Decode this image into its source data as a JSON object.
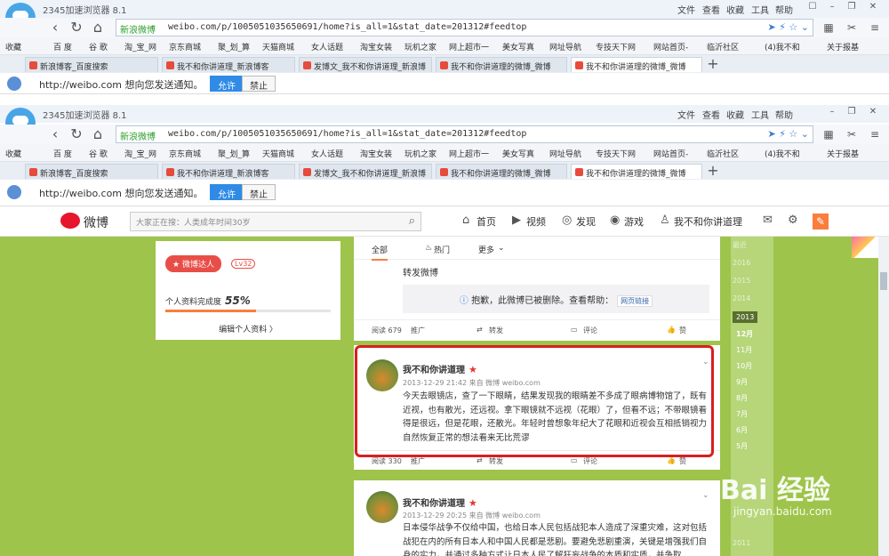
{
  "browser": {
    "app_title": "2345加速浏览器 8.1",
    "menus": [
      "文件",
      "查看",
      "收藏",
      "工具",
      "帮助"
    ],
    "site_label": "新浪微博",
    "url": "weibo.com/p/1005051035650691/home?is_all=1&stat_date=201312#feedtop",
    "bookmarks": [
      "收藏",
      "百 度",
      "谷 歌",
      "淘_宝_网",
      "京东商城",
      "聚_划_算",
      "天猫商城",
      "女人话题",
      "淘宝女装",
      "玩机之家",
      "网上超市一",
      "美女写真",
      "网址导航",
      "专技天下网",
      "网站首页-",
      "临沂社区",
      "(4)我不和",
      "关于报基"
    ],
    "tabs": [
      "新浪博客_百度搜索",
      "我不和你讲道理_新浪博客",
      "发博文_我不和你讲道理_新浪博",
      "我不和你讲道理的微博_微博",
      "我不和你讲道理的微博_微博"
    ],
    "notification": {
      "text": "http://weibo.com 想向您发送通知。",
      "allow": "允许",
      "deny": "禁止"
    }
  },
  "weibo": {
    "logo_text": "微博",
    "search_placeholder": "大家正在搜：人类成年时间30岁",
    "nav": [
      "首页",
      "视频",
      "发现",
      "游戏",
      "我不和你讲道理"
    ]
  },
  "profile": {
    "badge": "微博达人",
    "level": "Lv32",
    "completeness_label": "个人资料完成度",
    "completeness": "55%",
    "completeness_fraction": 0.55,
    "edit_link": "编辑个人资料 〉"
  },
  "feed": {
    "tabs": [
      "全部",
      "热门",
      "更多"
    ],
    "card1": {
      "repost_label": "转发微博",
      "deleted_text": "抱歉，此微博已被删除。查看帮助：",
      "web_link": "网页链接",
      "actions": [
        "阅读 679",
        "推广",
        "转发",
        "评论",
        "赞"
      ]
    },
    "post1": {
      "user": "我不和你讲道理",
      "meta": "2013-12-29 21:42 来自 微博 weibo.com",
      "text": "今天去眼镜店，查了一下眼睛，结果发现我的眼睛差不多成了眼病博物馆了，既有近视，也有散光，还远视。拿下眼镜就不远视（花眼）了，但看不远；不带眼镜看得是很远，但是花眼，还散光。年轻时曾想象年纪大了花眼和近视会互相抵销视力自然恢复正常的想法看来无比荒谬",
      "actions": [
        "阅读 330",
        "推广",
        "转发",
        "评论",
        "赞"
      ]
    },
    "post2": {
      "user": "我不和你讲道理",
      "meta": "2013-12-29 20:25 来自 微博 weibo.com",
      "text": "日本侵华战争不仅给中国，也给日本人民包括战犯本人造成了深重灾难，这对包括战犯在内的所有日本人和中国人民都是悲剧。要避免悲剧重演，关键是增强我们自身的实力，并通过多种方式让日本人民了解狂妄战争的本质和实质，并争取"
    }
  },
  "timeline": {
    "years": [
      "2016",
      "2015",
      "2014",
      "2013",
      "2011"
    ],
    "recent": "最近",
    "months": [
      "12月",
      "11月",
      "10月",
      "9月",
      "8月",
      "7月",
      "6月",
      "5月"
    ]
  },
  "watermark": {
    "text": "Bai 经验",
    "sub": "jingyan.baidu.com"
  },
  "colors": {
    "accent": "#fa7d3c",
    "highlight": "#d81f1f",
    "page_bg": "#9ec44b",
    "weibo_red": "#e6162d"
  }
}
